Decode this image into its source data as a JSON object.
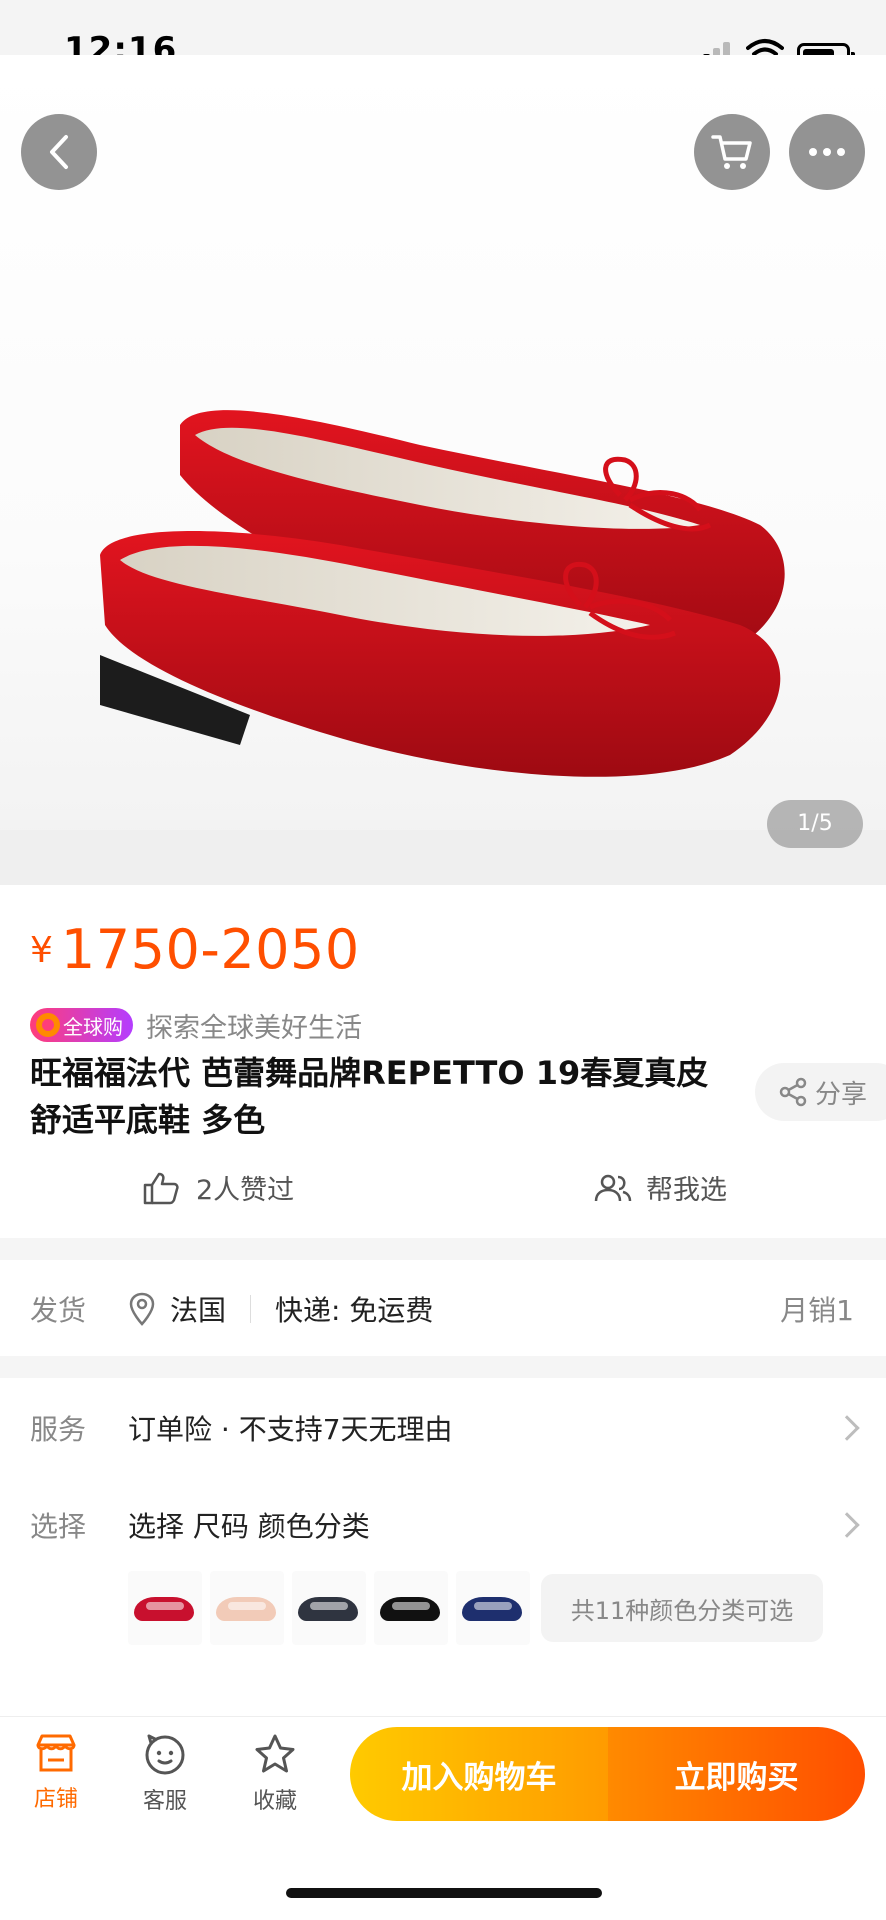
{
  "status_bar": {
    "time": "12:16"
  },
  "hero": {
    "page_indicator": "1/5"
  },
  "price": {
    "symbol": "¥",
    "value": "1750-2050"
  },
  "badge": {
    "label": "全球购",
    "slogan": "探索全球美好生活"
  },
  "product": {
    "title": "旺福福法代 芭蕾舞品牌REPETTO 19春夏真皮舒适平底鞋 多色",
    "share_label": "分享",
    "likes_label": "2人赞过",
    "help_choose_label": "帮我选"
  },
  "shipping": {
    "label": "发货",
    "origin": "法国",
    "express": "快递: 免运费",
    "monthly_sales": "月销1"
  },
  "service": {
    "label": "服务",
    "value": "订单险 · 不支持7天无理由"
  },
  "selection": {
    "label": "选择",
    "value": "选择  尺码 颜色分类",
    "variants_note": "共11种颜色分类可选",
    "thumbnail_colors": [
      "#c8102e",
      "#f2cbb8",
      "#2f3440",
      "#111111",
      "#1e2f6e"
    ]
  },
  "bottom_bar": {
    "store_label": "店铺",
    "service_label": "客服",
    "favorite_label": "收藏",
    "add_to_cart": "加入购物车",
    "buy_now": "立即购买"
  },
  "colors": {
    "accent": "#ff4f00",
    "cart_button": "#ffb400",
    "buy_button": "#ff6a00"
  }
}
